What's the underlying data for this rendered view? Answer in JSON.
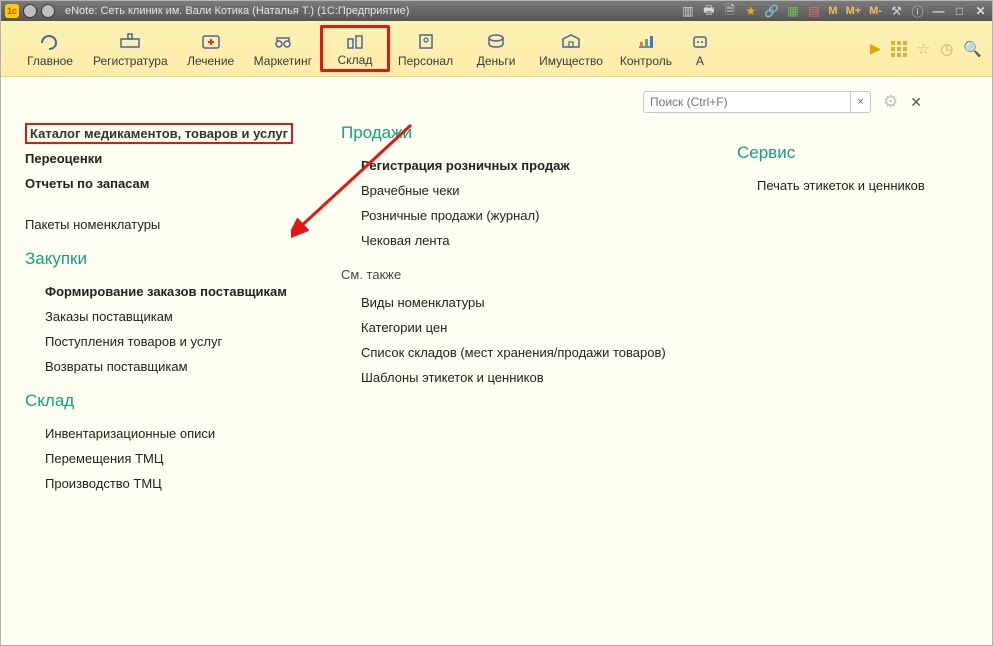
{
  "title": "eNote: Сеть клиник им. Вали Котика (Наталья Т.)  (1С:Предприятие)",
  "titlebar_icons": {
    "m": "M",
    "mplus": "M+",
    "mminus": "M-"
  },
  "toolbar": {
    "sections": [
      {
        "id": "main",
        "label": "Главное"
      },
      {
        "id": "reg",
        "label": "Регистратура"
      },
      {
        "id": "treat",
        "label": "Лечение"
      },
      {
        "id": "marketing",
        "label": "Маркетинг"
      },
      {
        "id": "warehouse",
        "label": "Склад",
        "active": true
      },
      {
        "id": "staff",
        "label": "Персонал"
      },
      {
        "id": "money",
        "label": "Деньги"
      },
      {
        "id": "assets",
        "label": "Имущество"
      },
      {
        "id": "control",
        "label": "Контроль"
      },
      {
        "id": "auto",
        "label": "А"
      }
    ]
  },
  "search": {
    "placeholder": "Поиск (Ctrl+F)",
    "clear": "×"
  },
  "columns": {
    "left": {
      "top": [
        {
          "label": "Каталог медикаментов, товаров и услуг",
          "highlight": true
        },
        {
          "label": "Переоценки",
          "bold": true
        },
        {
          "label": "Отчеты по запасам",
          "bold": true
        },
        {
          "label": "Пакеты номенклатуры",
          "spaced": true
        }
      ],
      "purchases": {
        "title": "Закупки",
        "items": [
          {
            "label": "Формирование заказов поставщикам",
            "bold": true
          },
          {
            "label": "Заказы поставщикам"
          },
          {
            "label": "Поступления товаров и услуг"
          },
          {
            "label": "Возвраты поставщикам"
          }
        ]
      },
      "warehouse": {
        "title": "Склад",
        "items": [
          {
            "label": "Инвентаризационные описи"
          },
          {
            "label": "Перемещения ТМЦ"
          },
          {
            "label": "Производство ТМЦ"
          }
        ]
      }
    },
    "mid": {
      "sales": {
        "title": "Продажи",
        "items": [
          {
            "label": "Регистрация розничных продаж",
            "bold": true
          },
          {
            "label": "Врачебные чеки"
          },
          {
            "label": "Розничные продажи (журнал)"
          },
          {
            "label": "Чековая лента"
          }
        ]
      },
      "seealso": {
        "title": "См. также",
        "items": [
          {
            "label": "Виды номенклатуры"
          },
          {
            "label": "Категории цен"
          },
          {
            "label": "Список складов (мест хранения/продажи товаров)"
          },
          {
            "label": "Шаблоны этикеток и ценников"
          }
        ]
      }
    },
    "right": {
      "service": {
        "title": "Сервис",
        "items": [
          {
            "label": "Печать этикеток и ценников"
          }
        ]
      }
    }
  }
}
